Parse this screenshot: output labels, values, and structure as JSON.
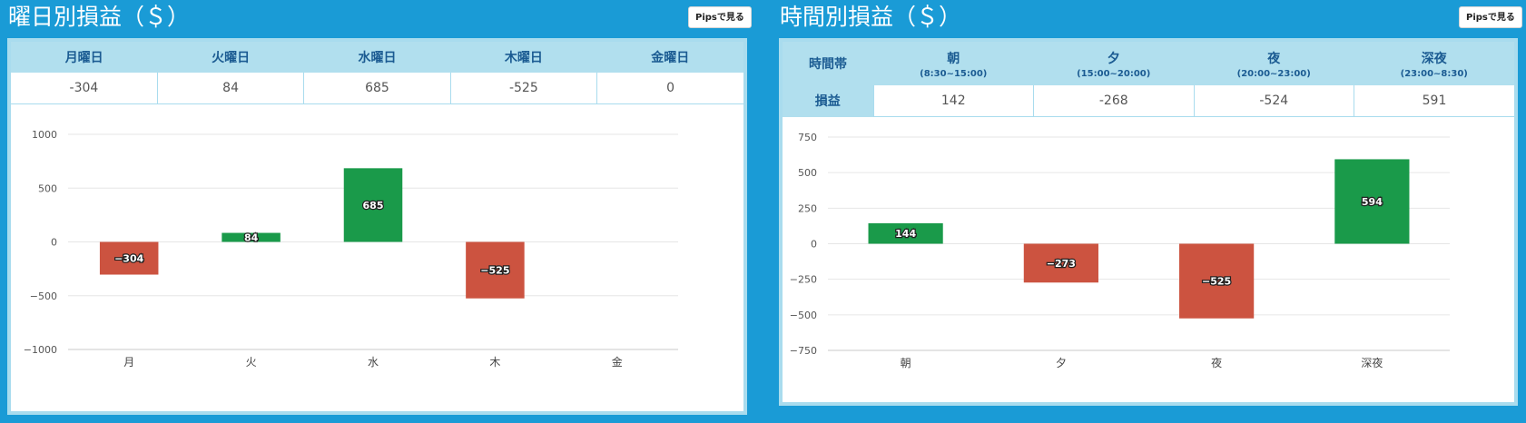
{
  "colors": {
    "positive": "#1a9a4a",
    "negative": "#cc5340",
    "background": "#1a9bd6",
    "header": "#b1dfee"
  },
  "weekday": {
    "title": "曜日別損益（＄）",
    "pips_button": "Pipsで見る",
    "headers": [
      "月曜日",
      "火曜日",
      "水曜日",
      "木曜日",
      "金曜日"
    ],
    "values": [
      "-304",
      "84",
      "685",
      "-525",
      "0"
    ]
  },
  "timeslot": {
    "title": "時間別損益（＄）",
    "pips_button": "Pipsで見る",
    "row_header_time": "時間帯",
    "row_header_pl": "損益",
    "headers": [
      {
        "label": "朝",
        "range": "(8:30~15:00)"
      },
      {
        "label": "夕",
        "range": "(15:00~20:00)"
      },
      {
        "label": "夜",
        "range": "(20:00~23:00)"
      },
      {
        "label": "深夜",
        "range": "(23:00~8:30)"
      }
    ],
    "values": [
      "142",
      "-268",
      "-524",
      "591"
    ]
  },
  "chart_data": [
    {
      "type": "bar",
      "categories": [
        "月",
        "火",
        "水",
        "木",
        "金"
      ],
      "values": [
        -304,
        84,
        685,
        -525,
        0
      ],
      "data_labels": [
        "−304",
        "84",
        "685",
        "−525",
        ""
      ],
      "yticks": [
        1000,
        500,
        0,
        -500,
        -1000
      ],
      "ytick_labels": [
        "1000",
        "500",
        "0",
        "−500",
        "−1000"
      ],
      "ylim": [
        -1000,
        1000
      ],
      "grid": true
    },
    {
      "type": "bar",
      "categories": [
        "朝",
        "夕",
        "夜",
        "深夜"
      ],
      "values": [
        144,
        -273,
        -525,
        594
      ],
      "data_labels": [
        "144",
        "−273",
        "−525",
        "594"
      ],
      "yticks": [
        750,
        500,
        250,
        0,
        -250,
        -500,
        -750
      ],
      "ytick_labels": [
        "750",
        "500",
        "250",
        "0",
        "−250",
        "−500",
        "−750"
      ],
      "ylim": [
        -750,
        750
      ],
      "grid": true
    }
  ]
}
